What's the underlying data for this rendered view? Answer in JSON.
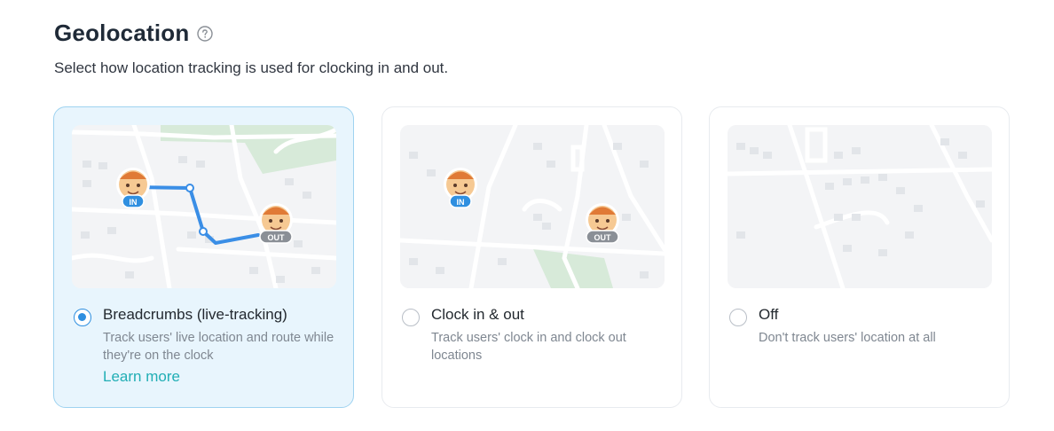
{
  "header": {
    "title": "Geolocation",
    "help_icon": "question-circle-icon",
    "subtitle": "Select how location tracking is used for clocking in and out."
  },
  "options": [
    {
      "title": "Breadcrumbs (live-tracking)",
      "description": "Track users' live location and route while they're on the clock",
      "link": "Learn more",
      "selected": true,
      "markers": [
        "IN",
        "OUT"
      ]
    },
    {
      "title": "Clock in & out",
      "description": "Track users' clock in and clock out locations",
      "selected": false,
      "markers": [
        "IN",
        "OUT"
      ]
    },
    {
      "title": "Off",
      "description": "Don't track users' location at all",
      "selected": false
    }
  ],
  "colors": {
    "accent": "#2f8fe0",
    "selected_card_bg": "#e8f5fd",
    "selected_card_border": "#9fd3f0",
    "link": "#21aeb5",
    "route": "#3a8ee6",
    "park": "#d7ead9",
    "marker_in": "#2f8fe0",
    "marker_out": "#8a8f96"
  }
}
